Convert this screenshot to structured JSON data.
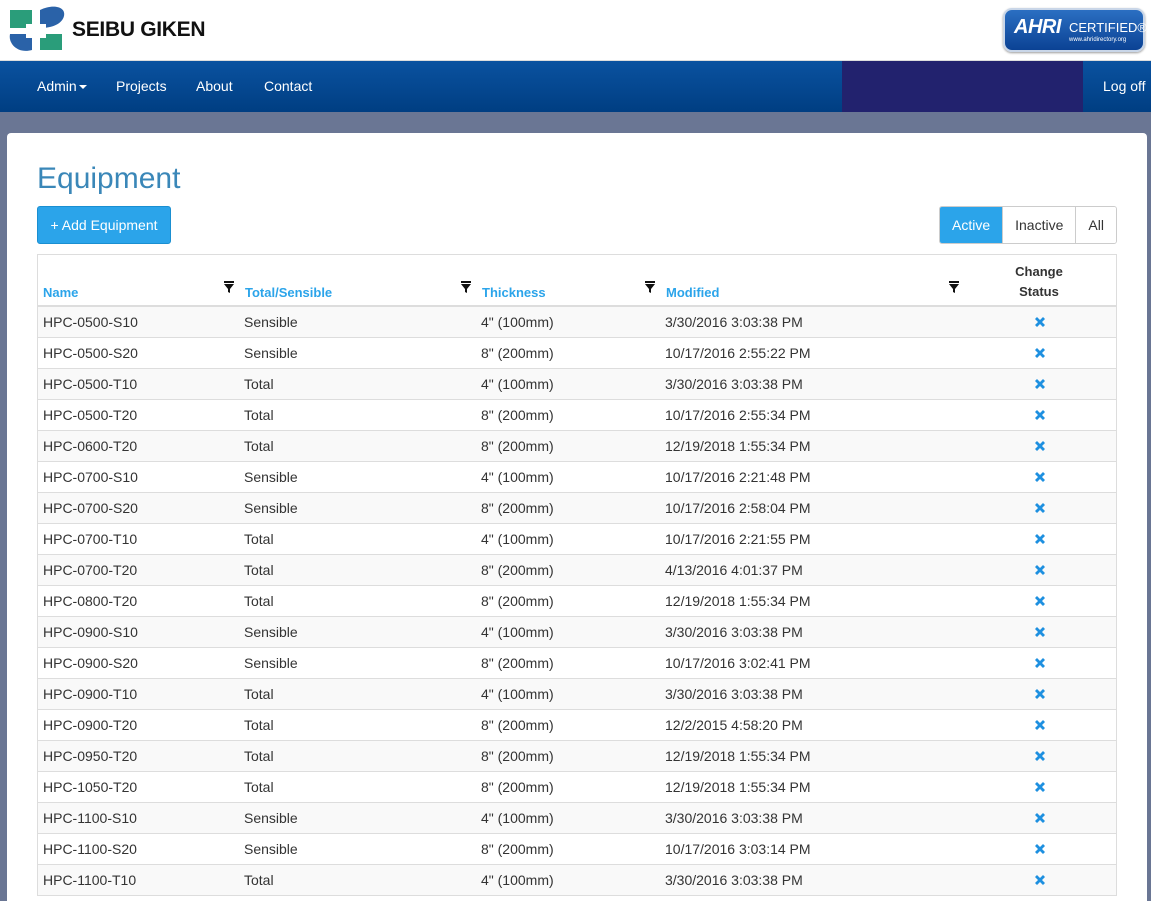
{
  "header": {
    "brand": "SEIBU GIKEN",
    "badge_big": "AHRI",
    "badge_certified": "CERTIFIED®",
    "badge_url": "www.ahridirectory.org"
  },
  "nav": {
    "admin": "Admin",
    "projects": "Projects",
    "about": "About",
    "contact": "Contact",
    "logoff": "Log off"
  },
  "page": {
    "title": "Equipment",
    "add_button": "+ Add Equipment",
    "filters": {
      "active": "Active",
      "inactive": "Inactive",
      "all": "All",
      "selected": "Active"
    }
  },
  "table": {
    "columns": [
      "Name",
      "Total/Sensible",
      "Thickness",
      "Modified",
      "Change Status"
    ],
    "change_status_line1": "Change",
    "change_status_line2": "Status",
    "rows": [
      {
        "name": "HPC-0500-S10",
        "type": "Sensible",
        "thickness": "4\" (100mm)",
        "modified": "3/30/2016 3:03:38 PM"
      },
      {
        "name": "HPC-0500-S20",
        "type": "Sensible",
        "thickness": "8\" (200mm)",
        "modified": "10/17/2016 2:55:22 PM"
      },
      {
        "name": "HPC-0500-T10",
        "type": "Total",
        "thickness": "4\" (100mm)",
        "modified": "3/30/2016 3:03:38 PM"
      },
      {
        "name": "HPC-0500-T20",
        "type": "Total",
        "thickness": "8\" (200mm)",
        "modified": "10/17/2016 2:55:34 PM"
      },
      {
        "name": "HPC-0600-T20",
        "type": "Total",
        "thickness": "8\" (200mm)",
        "modified": "12/19/2018 1:55:34 PM"
      },
      {
        "name": "HPC-0700-S10",
        "type": "Sensible",
        "thickness": "4\" (100mm)",
        "modified": "10/17/2016 2:21:48 PM"
      },
      {
        "name": "HPC-0700-S20",
        "type": "Sensible",
        "thickness": "8\" (200mm)",
        "modified": "10/17/2016 2:58:04 PM"
      },
      {
        "name": "HPC-0700-T10",
        "type": "Total",
        "thickness": "4\" (100mm)",
        "modified": "10/17/2016 2:21:55 PM"
      },
      {
        "name": "HPC-0700-T20",
        "type": "Total",
        "thickness": "8\" (200mm)",
        "modified": "4/13/2016 4:01:37 PM"
      },
      {
        "name": "HPC-0800-T20",
        "type": "Total",
        "thickness": "8\" (200mm)",
        "modified": "12/19/2018 1:55:34 PM"
      },
      {
        "name": "HPC-0900-S10",
        "type": "Sensible",
        "thickness": "4\" (100mm)",
        "modified": "3/30/2016 3:03:38 PM"
      },
      {
        "name": "HPC-0900-S20",
        "type": "Sensible",
        "thickness": "8\" (200mm)",
        "modified": "10/17/2016 3:02:41 PM"
      },
      {
        "name": "HPC-0900-T10",
        "type": "Total",
        "thickness": "4\" (100mm)",
        "modified": "3/30/2016 3:03:38 PM"
      },
      {
        "name": "HPC-0900-T20",
        "type": "Total",
        "thickness": "8\" (200mm)",
        "modified": "12/2/2015 4:58:20 PM"
      },
      {
        "name": "HPC-0950-T20",
        "type": "Total",
        "thickness": "8\" (200mm)",
        "modified": "12/19/2018 1:55:34 PM"
      },
      {
        "name": "HPC-1050-T20",
        "type": "Total",
        "thickness": "8\" (200mm)",
        "modified": "12/19/2018 1:55:34 PM"
      },
      {
        "name": "HPC-1100-S10",
        "type": "Sensible",
        "thickness": "4\" (100mm)",
        "modified": "3/30/2016 3:03:38 PM"
      },
      {
        "name": "HPC-1100-S20",
        "type": "Sensible",
        "thickness": "8\" (200mm)",
        "modified": "10/17/2016 3:03:14 PM"
      },
      {
        "name": "HPC-1100-T10",
        "type": "Total",
        "thickness": "4\" (100mm)",
        "modified": "3/30/2016 3:03:38 PM"
      }
    ]
  },
  "colors": {
    "accent": "#2ba4ea",
    "title": "#3a87b8",
    "navbar": "#0a52a0",
    "remove_icon": "#1e90e0"
  },
  "icons": {
    "filter": "filter-icon",
    "remove": "remove-x-icon",
    "caret": "caret-down-icon",
    "logo": "seibu-giken-logo"
  }
}
